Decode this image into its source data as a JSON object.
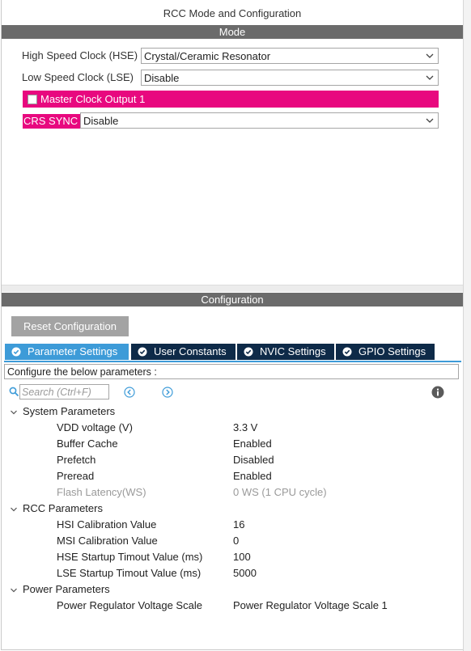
{
  "window": {
    "title": "RCC Mode and Configuration"
  },
  "mode": {
    "header": "Mode",
    "hse": {
      "label": "High Speed Clock (HSE)",
      "value": "Crystal/Ceramic Resonator"
    },
    "lse": {
      "label": "Low Speed Clock (LSE)",
      "value": "Disable"
    },
    "mco": {
      "label": "Master Clock Output 1",
      "checked": false
    },
    "crs": {
      "label": "CRS SYNC",
      "value": "Disable"
    }
  },
  "configuration": {
    "header": "Configuration",
    "reset_label": "Reset Configuration",
    "tabs": [
      {
        "label": "Parameter Settings",
        "active": true
      },
      {
        "label": "User Constants",
        "active": false
      },
      {
        "label": "NVIC Settings",
        "active": false
      },
      {
        "label": "GPIO Settings",
        "active": false
      }
    ],
    "instruction": "Configure the below parameters :",
    "search": {
      "placeholder": "Search (Ctrl+F)"
    },
    "groups": [
      {
        "name": "System Parameters",
        "params": [
          {
            "name": "VDD voltage (V)",
            "value": "3.3 V"
          },
          {
            "name": "Buffer Cache",
            "value": "Enabled"
          },
          {
            "name": "Prefetch",
            "value": "Disabled"
          },
          {
            "name": "Preread",
            "value": "Enabled"
          },
          {
            "name": "Flash Latency(WS)",
            "value": "0 WS (1 CPU cycle)"
          }
        ]
      },
      {
        "name": "RCC Parameters",
        "params": [
          {
            "name": "HSI Calibration Value",
            "value": "16"
          },
          {
            "name": "MSI Calibration Value",
            "value": "0"
          },
          {
            "name": "HSE Startup Timout Value (ms)",
            "value": "100"
          },
          {
            "name": "LSE Startup Timout Value (ms)",
            "value": "5000"
          }
        ]
      },
      {
        "name": "Power Parameters",
        "params": [
          {
            "name": "Power Regulator Voltage Scale",
            "value": "Power Regulator Voltage Scale 1"
          }
        ]
      }
    ]
  },
  "colors": {
    "accent_pink": "#e8087f",
    "tab_active": "#3d9bd8",
    "tab_inactive": "#0e2a48",
    "header_bar": "#6b6b6b"
  }
}
